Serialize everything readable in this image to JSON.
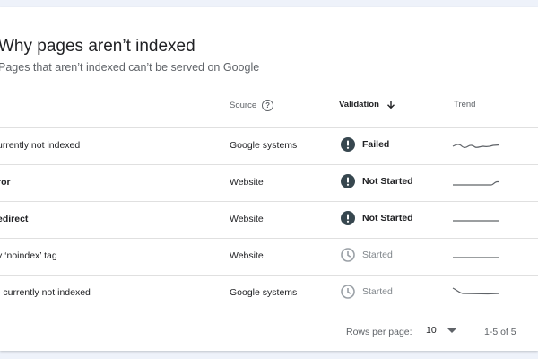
{
  "card": {
    "title": "Why pages aren’t indexed",
    "subtitle": "Pages that aren’t indexed can’t be served on Google"
  },
  "table": {
    "headers": {
      "source": "Source",
      "validation": "Validation",
      "trend": "Trend"
    },
    "rows": [
      {
        "reason": "urrently not indexed",
        "source": "Google systems",
        "validation": "Failed",
        "status": "failed"
      },
      {
        "reason": "ror",
        "source": "Website",
        "validation": "Not Started",
        "status": "not-started"
      },
      {
        "reason": "edirect",
        "source": "Website",
        "validation": "Not Started",
        "status": "not-started"
      },
      {
        "reason": "y ‘noindex’ tag",
        "source": "Website",
        "validation": "Started",
        "status": "started"
      },
      {
        "reason": "- currently not indexed",
        "source": "Google systems",
        "validation": "Started",
        "status": "started"
      }
    ]
  },
  "footer": {
    "rows_per_page_label": "Rows per page:",
    "rows_per_page_value": "10",
    "range": "1-5 of 5"
  },
  "colors": {
    "error_icon": "#37474f",
    "clock_icon": "#9aa0a6",
    "trend_line": "#5f6368"
  }
}
